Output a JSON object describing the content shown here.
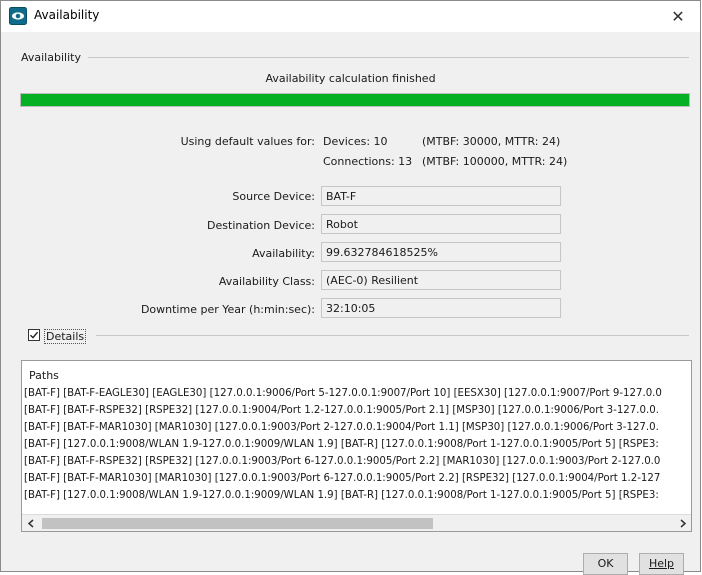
{
  "window": {
    "title": "Availability"
  },
  "group": {
    "title": "Availability"
  },
  "status_text": "Availability calculation finished",
  "progress": {
    "percent": 100,
    "color": "#06b025"
  },
  "defaults": {
    "label": "Using default values for:",
    "devices": "Devices: 10",
    "devices_values": "(MTBF: 30000, MTTR: 24)",
    "connections": "Connections: 13",
    "connections_values": "(MTBF: 100000, MTTR: 24)"
  },
  "fields": {
    "source_label": "Source Device:",
    "source_value": "BAT-F",
    "destination_label": "Destination Device:",
    "destination_value": "Robot",
    "availability_label": "Availability:",
    "availability_value": "99.632784618525%",
    "class_label": "Availability Class:",
    "class_value": "(AEC-0) Resilient",
    "downtime_label": "Downtime per Year (h:min:sec):",
    "downtime_value": "32:10:05"
  },
  "details": {
    "label": "Details",
    "checked": true
  },
  "paths": {
    "heading": "Paths",
    "rows": [
      "[BAT-F] [BAT-F-EAGLE30] [EAGLE30] [127.0.0.1:9006/Port 5-127.0.0.1:9007/Port 10] [EESX30] [127.0.0.1:9007/Port 9-127.0.0",
      "[BAT-F] [BAT-F-RSPE32] [RSPE32] [127.0.0.1:9004/Port 1.2-127.0.0.1:9005/Port 2.1] [MSP30] [127.0.0.1:9006/Port 3-127.0.0.",
      "[BAT-F] [BAT-F-MAR1030] [MAR1030] [127.0.0.1:9003/Port 2-127.0.0.1:9004/Port 1.1] [MSP30] [127.0.0.1:9006/Port 3-127.0.",
      "[BAT-F] [127.0.0.1:9008/WLAN 1.9-127.0.0.1:9009/WLAN 1.9] [BAT-R] [127.0.0.1:9008/Port 1-127.0.0.1:9005/Port 5] [RSPE3:",
      "[BAT-F] [BAT-F-RSPE32] [RSPE32] [127.0.0.1:9003/Port 6-127.0.0.1:9005/Port 2.2] [MAR1030] [127.0.0.1:9003/Port 2-127.0.0",
      "[BAT-F] [BAT-F-MAR1030] [MAR1030] [127.0.0.1:9003/Port 6-127.0.0.1:9005/Port 2.2] [RSPE32] [127.0.0.1:9004/Port 1.2-127",
      "[BAT-F] [127.0.0.1:9008/WLAN 1.9-127.0.0.1:9009/WLAN 1.9] [BAT-R] [127.0.0.1:9008/Port 1-127.0.0.1:9005/Port 5] [RSPE3:"
    ]
  },
  "buttons": {
    "ok": "OK",
    "help": "Help"
  },
  "icons": {
    "app": "eye-app-icon",
    "close": "close-icon",
    "scroll_left": "chevron-left-icon",
    "scroll_right": "chevron-right-icon"
  }
}
